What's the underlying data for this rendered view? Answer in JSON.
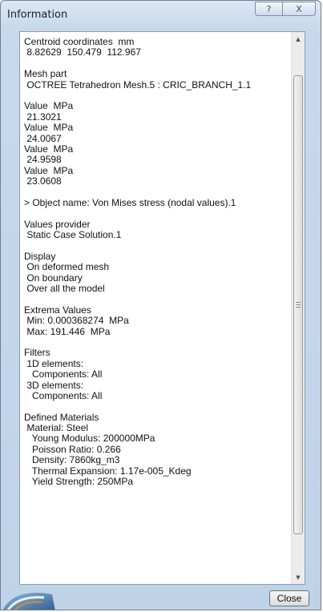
{
  "window": {
    "title": "Information",
    "help_glyph": "?",
    "close_glyph": "X"
  },
  "content": {
    "lines": [
      "Centroid coordinates  mm",
      " 8.82629  150.479  112.967",
      "",
      "Mesh part",
      " OCTREE Tetrahedron Mesh.5 : CRIC_BRANCH_1.1",
      "",
      "Value  MPa",
      " 21.3021",
      "Value  MPa",
      " 24.0067",
      "Value  MPa",
      " 24.9598",
      "Value  MPa",
      " 23.0608",
      "",
      "> Object name: Von Mises stress (nodal values).1",
      "",
      "Values provider",
      " Static Case Solution.1",
      "",
      "Display",
      " On deformed mesh",
      " On boundary",
      " Over all the model",
      "",
      "Extrema Values",
      " Min: 0.000368274  MPa",
      " Max: 191.446  MPa",
      "",
      "Filters",
      " 1D elements:",
      "   Components: All",
      " 3D elements:",
      "   Components: All",
      "",
      "Defined Materials",
      " Material: Steel",
      "   Young Modulus: 200000MPa",
      "   Poisson Ratio: 0.266",
      "   Density: 7860kg_m3",
      "   Thermal Expansion: 1.17e-005_Kdeg",
      "   Yield Strength: 250MPa"
    ]
  },
  "buttons": {
    "close_label": "Close"
  },
  "icons": {
    "help": "help-icon",
    "close": "close-icon",
    "scroll_up": "scroll-up-arrow-icon",
    "scroll_down": "scroll-down-arrow-icon",
    "logo": "app-logo-icon"
  },
  "colors": {
    "window_bg": "#c7d9ec",
    "content_bg": "#ffffff",
    "text": "#111111"
  }
}
